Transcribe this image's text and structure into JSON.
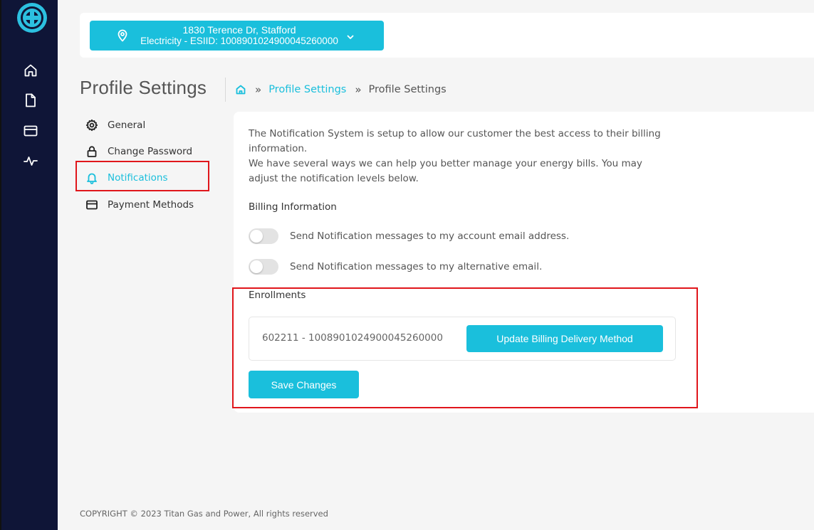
{
  "account": {
    "address": "1830 Terence Dr, Stafford",
    "service": "Electricity - ESIID: 1008901024900045260000"
  },
  "page": {
    "title": "Profile Settings",
    "breadcrumb": [
      "Profile Settings",
      "Profile Settings"
    ],
    "breadcrumb_separator": "»"
  },
  "menu": {
    "items": [
      {
        "label": "General",
        "icon": "gear-icon"
      },
      {
        "label": "Change Password",
        "icon": "lock-icon"
      },
      {
        "label": "Notifications",
        "icon": "bell-icon",
        "active": true
      },
      {
        "label": "Payment Methods",
        "icon": "credit-card-icon"
      }
    ]
  },
  "notifications": {
    "intro_1": "The Notification System is setup to allow our customer the best access to their billing information.",
    "intro_2": "We have several ways we can help you better manage your energy bills. You may adjust the notification levels below.",
    "billing_heading": "Billing Information",
    "toggles": [
      {
        "label": "Send Notification messages to my account email address.",
        "on": false
      },
      {
        "label": "Send Notification messages to my alternative email.",
        "on": false
      }
    ],
    "enrollments_heading": "Enrollments",
    "enrollment_id": "602211 - 1008901024900045260000",
    "update_button": "Update Billing Delivery Method",
    "save_button": "Save Changes"
  },
  "footer": "COPYRIGHT © 2023 Titan Gas and Power, All rights reserved",
  "colors": {
    "accent": "#1abfdc",
    "rail": "#0f1537",
    "highlight": "#e0161b"
  }
}
